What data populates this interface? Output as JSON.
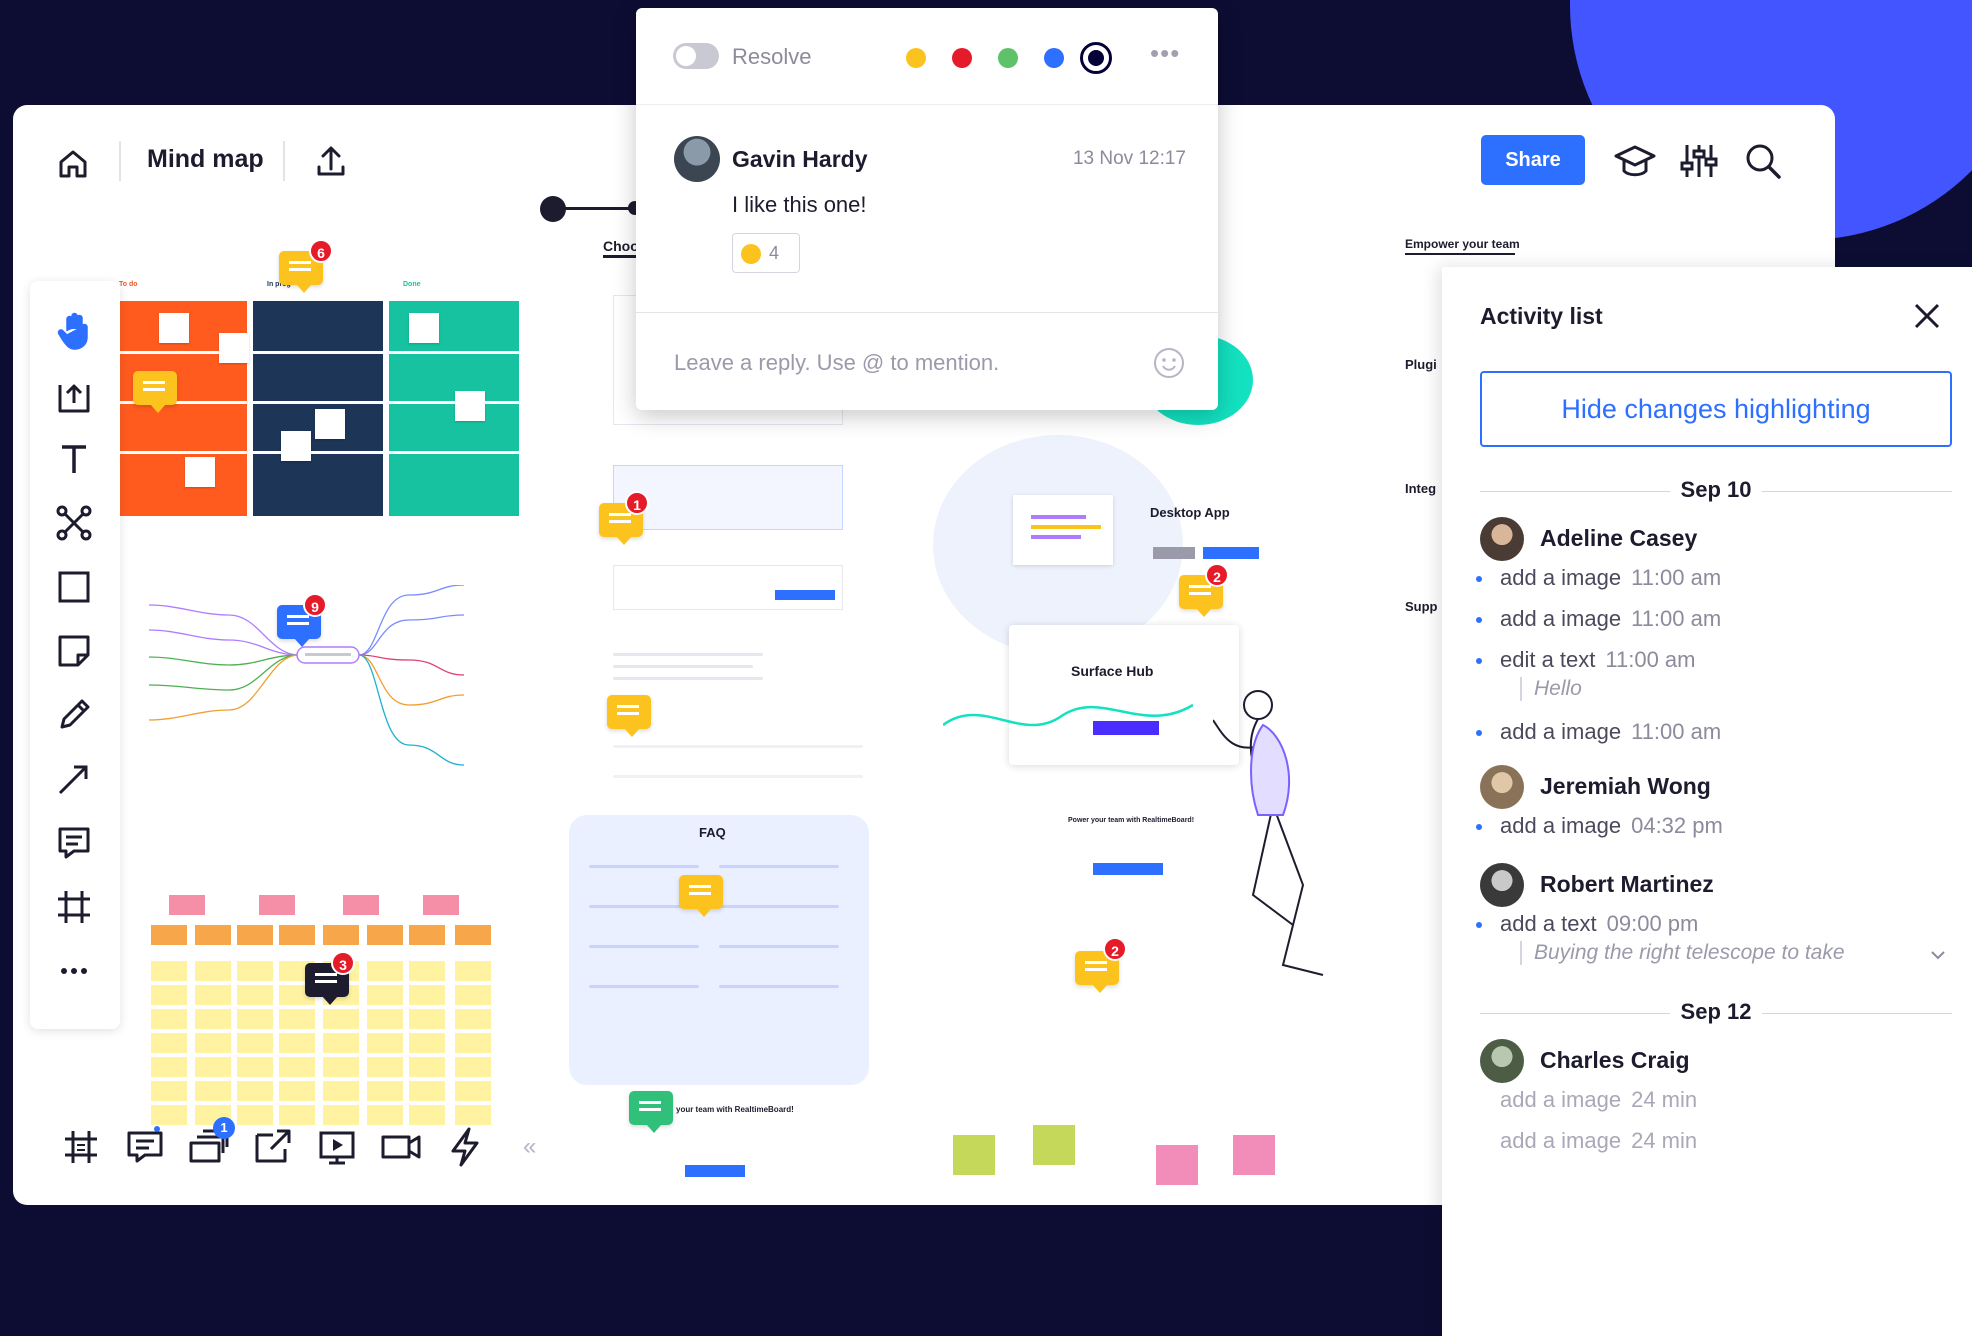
{
  "header": {
    "board_title": "Mind map",
    "share_label": "Share"
  },
  "comment": {
    "resolve_label": "Resolve",
    "colors": [
      "#fcc31e",
      "#e61b2a",
      "#5ec26a",
      "#2d6fff",
      "#050038"
    ],
    "selected_color": "#050038",
    "author": "Gavin Hardy",
    "timestamp": "13 Nov 12:17",
    "text": "I like this one!",
    "reaction_count": "4",
    "reply_placeholder": "Leave a reply. Use @ to mention."
  },
  "board": {
    "kanban_headers": [
      "To do",
      "In prog",
      "Done"
    ],
    "badges": {
      "kanban": "6",
      "mindmap": "9",
      "sticky_grid": "3",
      "plans": "1",
      "desktop": "2",
      "footer": "2",
      "bottombar": "1"
    },
    "snippets": {
      "choose": "Choo",
      "empower": "Empower your team",
      "plugins": "Plugi",
      "integ": "Integ",
      "supp": "Supp",
      "desktop_app": "Desktop App",
      "surface_hub": "Surface Hub",
      "faq": "FAQ",
      "power_team": "Power your team with RealtimeBoard!",
      "your_team": "your team with RealtimeBoard!"
    }
  },
  "activity": {
    "title": "Activity list",
    "hide_button": "Hide changes highlighting",
    "days": [
      {
        "label": "Sep 10",
        "users": [
          {
            "name": "Adeline Casey",
            "items": [
              {
                "action": "add a image",
                "time": "11:00 am"
              },
              {
                "action": "add a image",
                "time": "11:00 am"
              },
              {
                "action": "edit a text",
                "time": "11:00 am",
                "quote": "Hello"
              },
              {
                "action": "add a image",
                "time": "11:00 am"
              }
            ]
          },
          {
            "name": "Jeremiah Wong",
            "items": [
              {
                "action": "add a image",
                "time": "04:32 pm"
              }
            ]
          },
          {
            "name": "Robert Martinez",
            "items": [
              {
                "action": "add a text",
                "time": "09:00 pm",
                "quote": "Buying the right telescope to take"
              }
            ]
          }
        ]
      },
      {
        "label": "Sep 12",
        "users": [
          {
            "name": "Charles Craig",
            "items": [
              {
                "action": "add a image",
                "time": "24 min"
              },
              {
                "action": "add a image",
                "time": "24 min"
              }
            ]
          }
        ]
      }
    ]
  },
  "icons": {
    "top": [
      "home-icon",
      "upload-icon",
      "graduation-cap-icon",
      "sliders-icon",
      "search-icon"
    ],
    "toolbar": [
      "hand-icon",
      "template-icon",
      "text-icon",
      "mindmap-icon",
      "rectangle-icon",
      "sticky-note-icon",
      "pen-icon",
      "arrow-icon",
      "comment-icon",
      "frame-icon",
      "more-icon"
    ],
    "bottombar": [
      "frames-icon",
      "comments-icon",
      "cards-icon",
      "share-screen-icon",
      "presentation-icon",
      "video-icon",
      "lightning-icon"
    ]
  }
}
